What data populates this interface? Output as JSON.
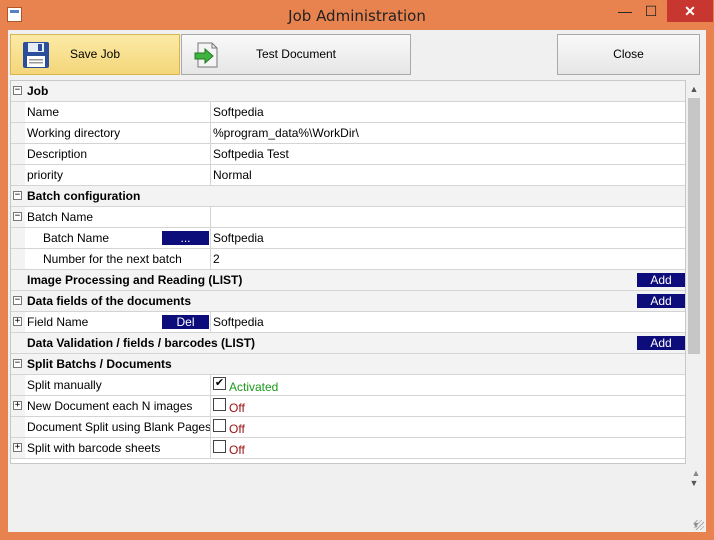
{
  "window": {
    "title": "Job Administration",
    "minimize": "—",
    "maximize": "☐",
    "close": "✕"
  },
  "toolbar": {
    "save_label": "Save Job",
    "test_label": "Test Document",
    "close_label": "Close"
  },
  "rows": [
    {
      "type": "cat",
      "toggle": "−",
      "label": "Job"
    },
    {
      "type": "prop",
      "label": "Name",
      "value": "Softpedia"
    },
    {
      "type": "prop",
      "label": "Working directory",
      "value": "%program_data%\\WorkDir\\"
    },
    {
      "type": "prop",
      "label": "Description",
      "value": "Softpedia Test"
    },
    {
      "type": "prop",
      "label": "priority",
      "value": "Normal"
    },
    {
      "type": "cat",
      "toggle": "−",
      "label": "Batch configuration"
    },
    {
      "type": "prop",
      "toggle": "−",
      "label": "Batch Name",
      "value": ""
    },
    {
      "type": "sub",
      "label": "Batch Name",
      "button": "...",
      "value": "Softpedia"
    },
    {
      "type": "sub",
      "label": "Number for the next batch",
      "value": "2"
    },
    {
      "type": "cat",
      "label": "Image Processing and Reading (LIST)",
      "add": "Add"
    },
    {
      "type": "cat",
      "toggle": "−",
      "label": "Data fields of the documents",
      "add": "Add"
    },
    {
      "type": "prop",
      "toggle": "+",
      "label": "Field Name",
      "button": "Del",
      "value": "Softpedia"
    },
    {
      "type": "cat",
      "label": "Data Validation / fields / barcodes (LIST)",
      "add": "Add"
    },
    {
      "type": "cat",
      "toggle": "−",
      "label": "Split Batchs / Documents"
    },
    {
      "type": "check",
      "label": "Split manually",
      "checked": "✔",
      "state": "Activated",
      "state_kind": "on"
    },
    {
      "type": "check",
      "toggle": "+",
      "label": "New Document each N images",
      "checked": "",
      "state": "Off",
      "state_kind": "off"
    },
    {
      "type": "check",
      "label": "Document Split using Blank Pages",
      "checked": "",
      "state": "Off",
      "state_kind": "off"
    },
    {
      "type": "check",
      "toggle": "+",
      "label": "Split with barcode sheets",
      "checked": "",
      "state": "Off",
      "state_kind": "off"
    }
  ],
  "scroll": {
    "up": "▲",
    "down": "▼"
  }
}
